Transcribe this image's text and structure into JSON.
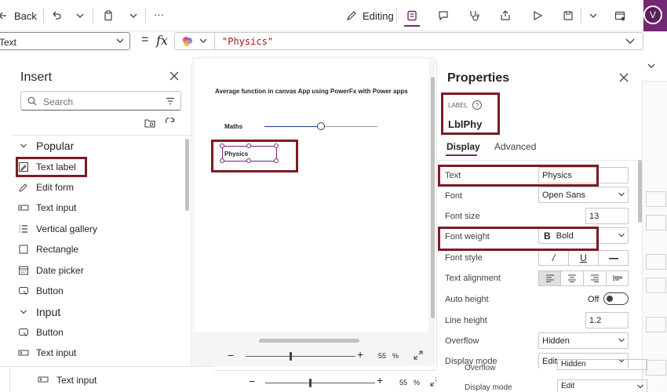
{
  "topbar": {
    "back_label": "Back",
    "more_label": "···",
    "editing_label": "Editing",
    "avatar_initial": "V"
  },
  "formula": {
    "property": "Text",
    "fx": "fx",
    "value": "\"Physics\""
  },
  "insert": {
    "title": "Insert",
    "search_placeholder": "Search",
    "sections": [
      {
        "label": "Popular",
        "items": [
          "Text label",
          "Edit form",
          "Text input",
          "Vertical gallery",
          "Rectangle",
          "Date picker",
          "Button"
        ]
      },
      {
        "label": "Input",
        "items": [
          "Button",
          "Text input"
        ]
      }
    ],
    "bottom_item": "Text input"
  },
  "canvas": {
    "title": "Average function in canvas App using PowerFx with Power apps",
    "slider_label": "Maths",
    "selected_label": "Physics",
    "zoom_value": "55",
    "zoom_unit": "%",
    "zoom_fraction": 0.4
  },
  "properties": {
    "title": "Properties",
    "type_label": "LABEL",
    "control_name": "LblPhy",
    "tabs": [
      "Display",
      "Advanced"
    ],
    "rows": [
      {
        "label": "Text",
        "value": "Physics"
      },
      {
        "label": "Font",
        "value": "Open Sans"
      },
      {
        "label": "Font size",
        "value": "13"
      },
      {
        "label": "Font weight",
        "value": "Bold",
        "glyph": "B"
      },
      {
        "label": "Font style",
        "value": ""
      },
      {
        "label": "Text alignment",
        "value": ""
      },
      {
        "label": "Auto height",
        "value": "Off"
      },
      {
        "label": "Line height",
        "value": "1.2"
      },
      {
        "label": "Overflow",
        "value": "Hidden"
      },
      {
        "label": "Display mode",
        "value": "Edit"
      }
    ],
    "ghost_overflow": "Overflow",
    "ghost_hidden": "Hidden",
    "ghost_display_mode": "Display mode",
    "ghost_edit": "Edit"
  },
  "bottom_zoom": {
    "value": "55",
    "unit": "%"
  },
  "colors": {
    "accent": "#742774",
    "highlight": "#7d1a24",
    "slider": "#1f3c8c"
  }
}
